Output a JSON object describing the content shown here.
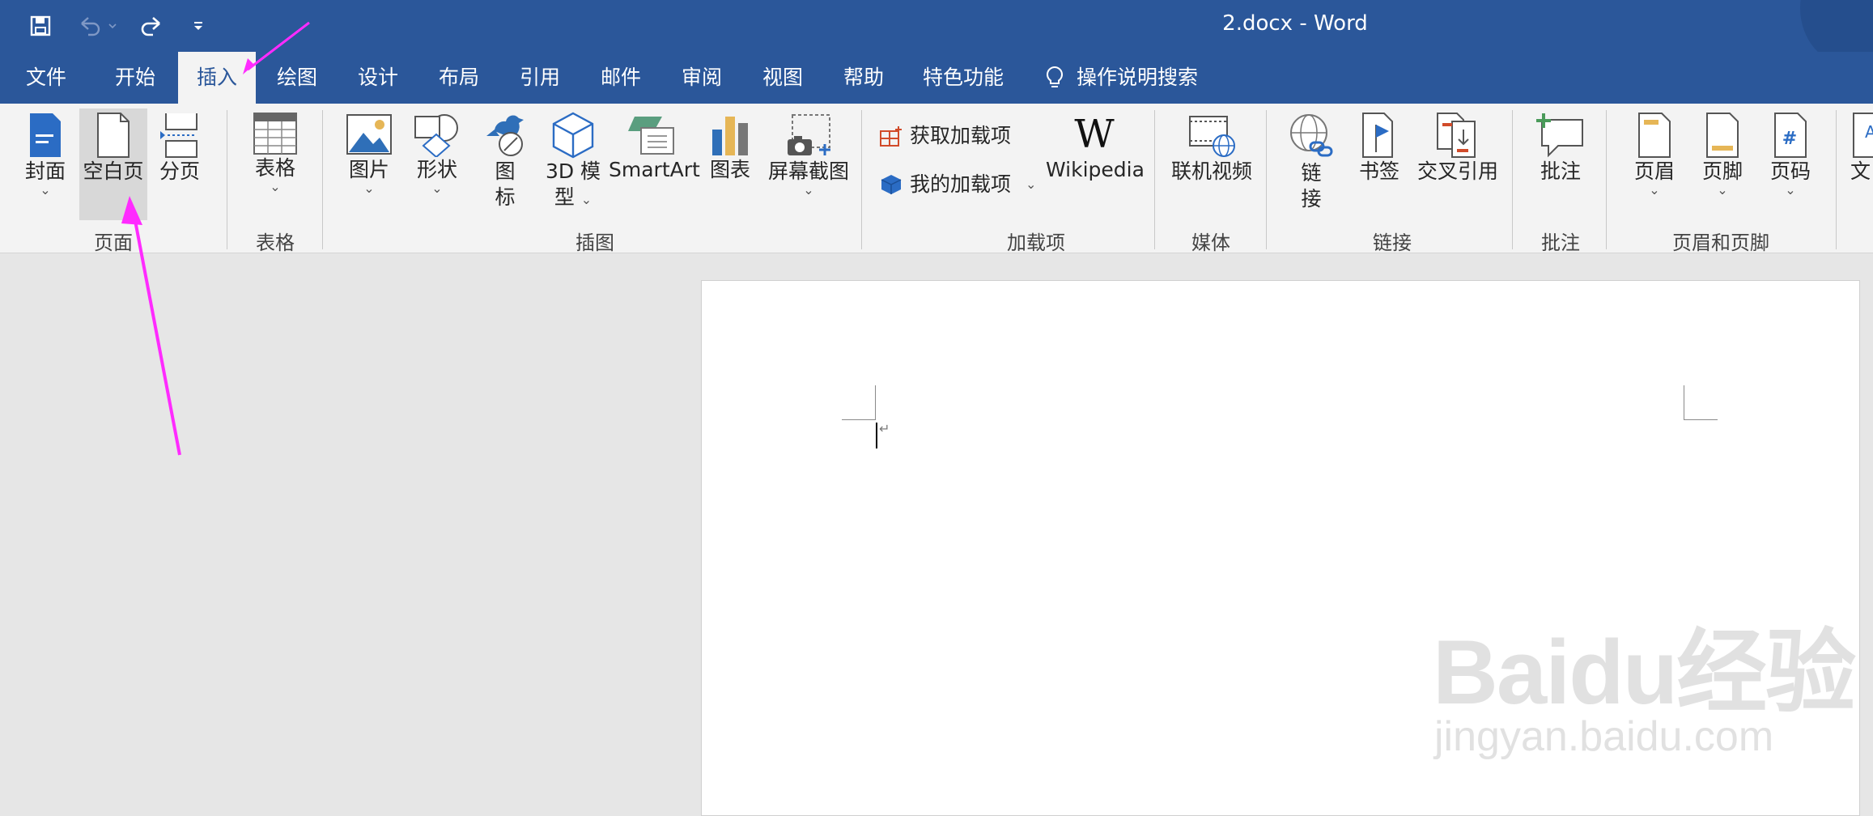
{
  "window": {
    "title": "2.docx  -  Word"
  },
  "quick_access": {
    "save_icon": "save-icon",
    "undo_icon": "undo-icon",
    "redo_icon": "redo-icon",
    "customize_icon": "customize-qat-icon"
  },
  "tabs": [
    "文件",
    "开始",
    "插入",
    "绘图",
    "设计",
    "布局",
    "引用",
    "邮件",
    "审阅",
    "视图",
    "帮助",
    "特色功能"
  ],
  "active_tab": "插入",
  "tell_me": {
    "label": "操作说明搜索",
    "icon": "lightbulb-icon"
  },
  "ribbon": {
    "pages_group": {
      "label": "页面",
      "cover": "封面",
      "blank_page": "空白页",
      "page_break": "分页"
    },
    "table_group": {
      "label": "表格",
      "table": "表格"
    },
    "illustrations_group": {
      "label": "插图",
      "pictures": "图片",
      "shapes": "形状",
      "icons_line1": "图",
      "icons_line2": "标",
      "model3d_line1": "3D 模",
      "model3d_line2": "型",
      "smartart": "SmartArt",
      "chart": "图表",
      "screenshot": "屏幕截图"
    },
    "addins_group": {
      "label": "加载项",
      "get_addins": "获取加载项",
      "my_addins": "我的加载项",
      "wikipedia": "Wikipedia"
    },
    "media_group": {
      "label": "媒体",
      "online_video": "联机视频"
    },
    "links_group": {
      "label": "链接",
      "link_line1": "链",
      "link_line2": "接",
      "bookmark": "书签",
      "cross_ref": "交叉引用"
    },
    "comments_group": {
      "label": "批注",
      "comment": "批注"
    },
    "header_footer_group": {
      "label": "页眉和页脚",
      "header": "页眉",
      "footer": "页脚",
      "page_number": "页码"
    },
    "text_group": {
      "textbox_partial": "文"
    }
  },
  "document": {
    "paragraph_mark": "↵"
  },
  "watermark": {
    "logo": "Baidu经验",
    "url": "jingyan.baidu.com"
  },
  "colors": {
    "title_bar": "#2b579a",
    "ribbon_bg": "#f3f3f3",
    "canvas": "#e6e6e6",
    "annotation_arrow": "#ff2bff"
  }
}
